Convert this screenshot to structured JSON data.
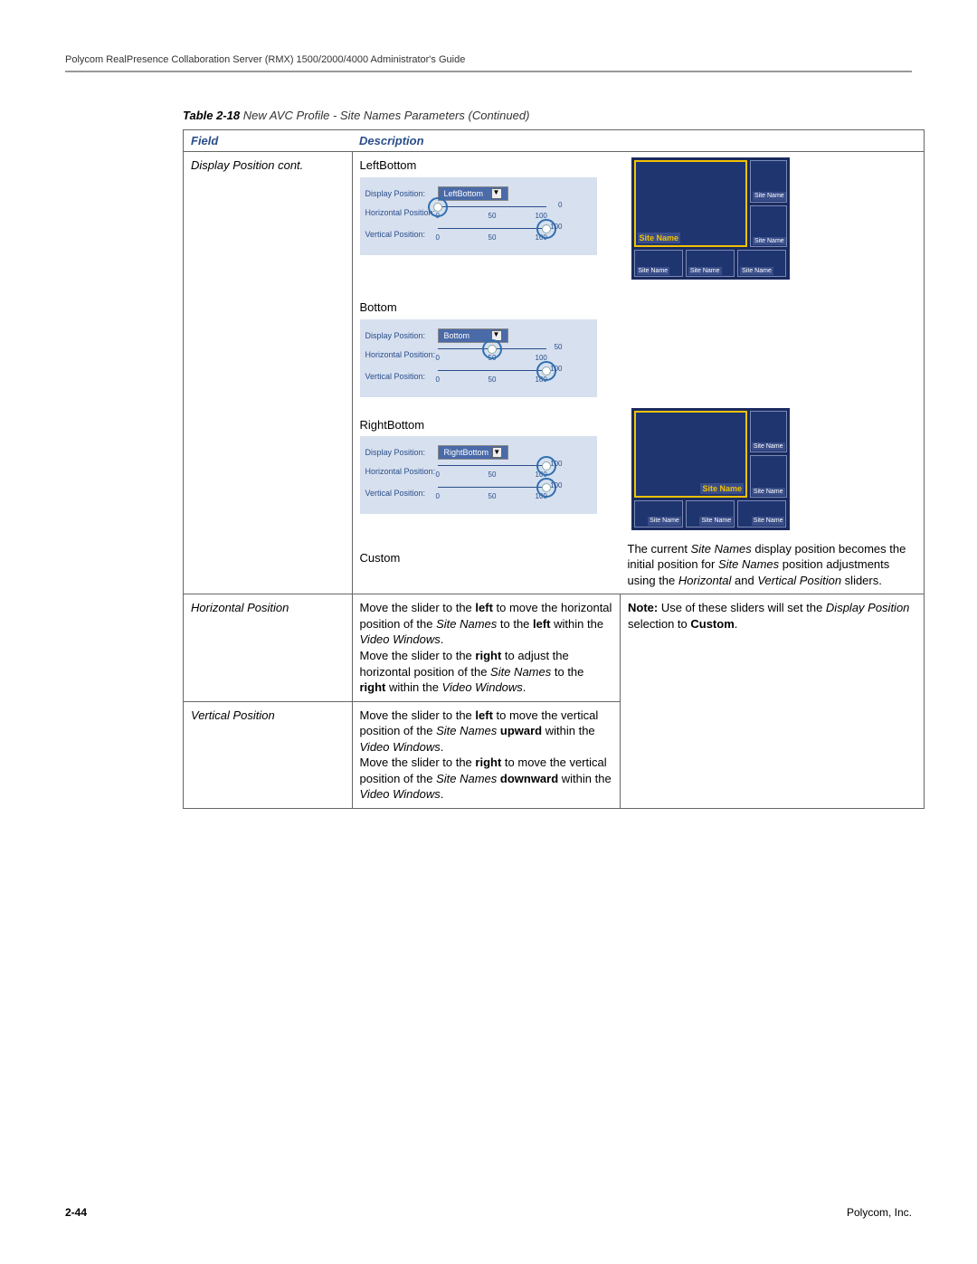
{
  "header": "Polycom RealPresence Collaboration Server (RMX) 1500/2000/4000 Administrator's Guide",
  "table_caption_id": "Table 2-18",
  "table_caption_rest": "New AVC Profile - Site Names Parameters (Continued)",
  "col_field": "Field",
  "col_desc": "Description",
  "row1_field": "Display Position\ncont.",
  "sect1_label": "LeftBottom",
  "sect2_label": "Bottom",
  "sect3_label": "RightBottom",
  "sect4_label": "Custom",
  "panel_lbl_display": "Display Position:",
  "panel_lbl_horiz": "Horizontal Position:",
  "panel_lbl_vert": "Vertical Position:",
  "opt_leftbottom": "LeftBottom",
  "opt_bottom": "Bottom",
  "opt_rightbottom": "RightBottom",
  "tick0": "0",
  "tick50": "50",
  "tick100": "100",
  "hv1_h": 0,
  "hv1_v": 100,
  "hv2_h": 50,
  "hv2_v": 100,
  "hv3_h": 100,
  "hv3_v": 100,
  "preview_site_name": "Site Name",
  "preview_small_label": "Site Name",
  "custom_text_pre": "The current ",
  "custom_text_sn": "Site Names",
  "custom_text_mid1": " display position becomes the initial position for ",
  "custom_text_mid2": " position adjustments using the ",
  "custom_text_hv": "Horizontal",
  "custom_text_and": " and ",
  "custom_text_v": "Vertical Position",
  "custom_text_end": " sliders.",
  "row2_field": "Horizontal Position",
  "row2_desc_1": "Move the slider to the ",
  "row2_left": "left",
  "row2_desc_2": " to move the horizontal position of the ",
  "row2_desc_3": " to the ",
  "row2_desc_4": " within the ",
  "video_windows": "Video Windows",
  "row2_desc_5": "Move the slider to the ",
  "row2_right": "right",
  "row2_desc_6": " to adjust the horizontal position of the ",
  "note_label": "Note:",
  "note_text_1": " Use of these sliders will set the ",
  "note_dp": "Display Position",
  "note_text_2": " selection to ",
  "note_custom": "Custom",
  "row3_field": "Vertical Position",
  "row3_desc_1": "Move the slider to the ",
  "row3_desc_2": " to move the vertical position of the ",
  "row3_up": "upward",
  "row3_desc_3": " within the ",
  "row3_desc_4": "Move the slider to the ",
  "row3_desc_5": " to move the vertical position of the ",
  "row3_down": "downward",
  "footer_page": "2-44",
  "footer_company": "Polycom, Inc."
}
